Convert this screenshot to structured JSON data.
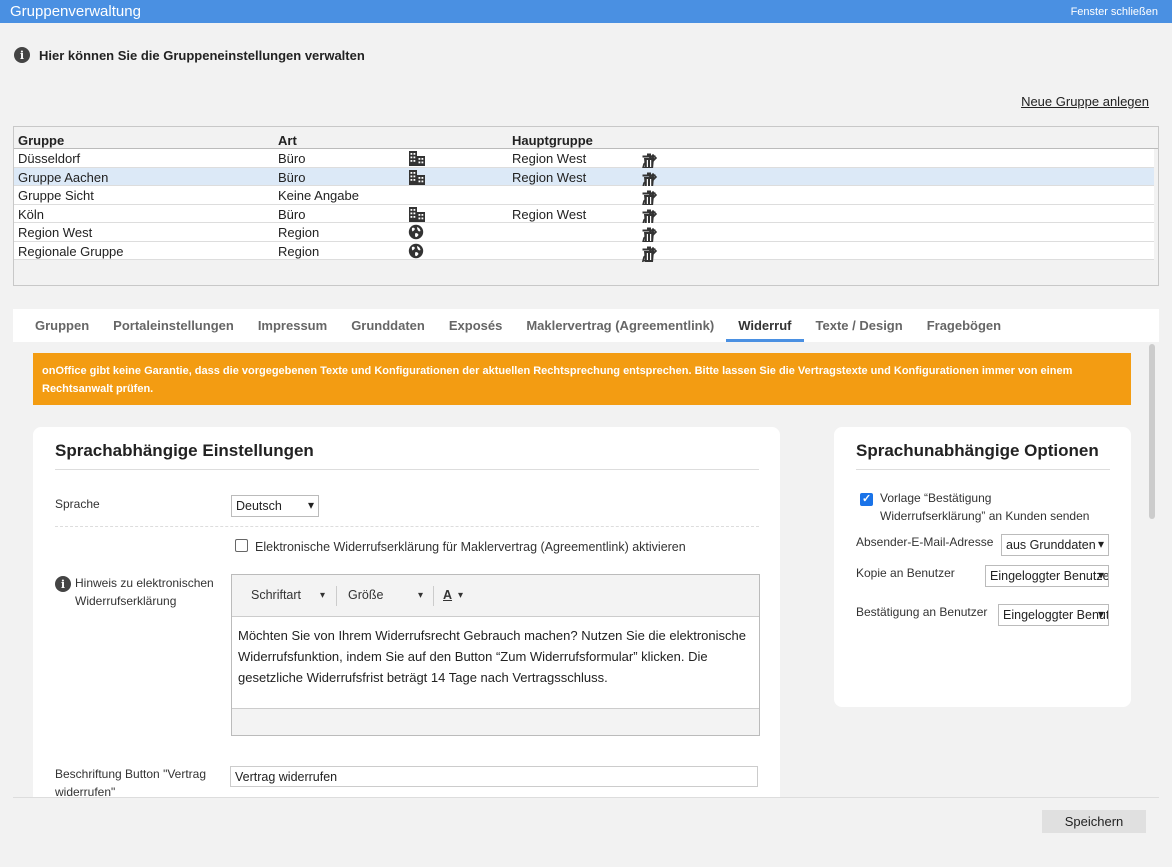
{
  "window": {
    "title": "Gruppenverwaltung",
    "close_label": "Fenster schließen"
  },
  "info": {
    "text": "Hier können Sie die Gruppeneinstellungen verwalten"
  },
  "new_group_label": "Neue Gruppe anlegen",
  "table": {
    "headers": {
      "gruppe": "Gruppe",
      "art": "Art",
      "hauptgruppe": "Hauptgruppe"
    },
    "rows": [
      {
        "gruppe": "Düsseldorf",
        "art": "Büro",
        "icon": "building-icon",
        "hauptgruppe": "Region West"
      },
      {
        "gruppe": "Gruppe Aachen",
        "art": "Büro",
        "icon": "building-icon",
        "hauptgruppe": "Region West"
      },
      {
        "gruppe": "Gruppe Sicht",
        "art": "Keine Angabe",
        "icon": "",
        "hauptgruppe": ""
      },
      {
        "gruppe": "Köln",
        "art": "Büro",
        "icon": "building-icon",
        "hauptgruppe": "Region West"
      },
      {
        "gruppe": "Region West",
        "art": "Region",
        "icon": "globe-icon",
        "hauptgruppe": ""
      },
      {
        "gruppe": "Regionale Gruppe",
        "art": "Region",
        "icon": "globe-icon",
        "hauptgruppe": ""
      }
    ]
  },
  "tabs": [
    {
      "label": "Gruppen"
    },
    {
      "label": "Portaleinstellungen"
    },
    {
      "label": "Impressum"
    },
    {
      "label": "Grunddaten"
    },
    {
      "label": "Exposés"
    },
    {
      "label": "Maklervertrag (Agreementlink)"
    },
    {
      "label": "Widerruf"
    },
    {
      "label": "Texte / Design"
    },
    {
      "label": "Fragebögen"
    }
  ],
  "warning": "onOffice gibt keine Garantie, dass die vorgegebenen Texte und Konfigurationen der aktuellen Rechtsprechung entsprechen. Bitte lassen Sie die Vertragstexte und Konfigurationen immer von einem Rechtsanwalt prüfen.",
  "left_card": {
    "title": "Sprachabhängige Einstellungen",
    "sprache_label": "Sprache",
    "sprache_value": "Deutsch",
    "checkbox_label": "Elektronische Widerrufserklärung für Maklervertrag (Agreementlink) aktivieren",
    "hinweis_label_1": "Hinweis zu elektronischen",
    "hinweis_label_2": "Widerrufserklärung",
    "editor": {
      "font_label": "Schriftart",
      "size_label": "Größe",
      "color_label": "A",
      "text": "Möchten Sie von Ihrem Widerrufsrecht Gebrauch machen? Nutzen Sie die elektronische Widerrufsfunktion, indem Sie auf den Button “Zum Widerrufsformular” klicken. Die gesetzliche Widerrufsfrist beträgt 14 Tage nach Vertragsschluss."
    },
    "button_label_1": "Beschriftung Button \"Vertrag",
    "button_label_2": "widerrufen\"",
    "button_value": "Vertrag widerrufen"
  },
  "right_card": {
    "title": "Sprachunabhängige Optionen",
    "vorlage_label_1": "Vorlage “Bestätigung",
    "vorlage_label_2": "Widerrufserklärung” an Kunden senden",
    "absender_label": "Absender-E-Mail-Adresse",
    "absender_value": "aus Grunddaten",
    "kopie_label": "Kopie an Benutzer",
    "kopie_value": "Eingeloggter Benutzer",
    "bestaetigung_label": "Bestätigung an Benutzer",
    "bestaetigung_value": "Eingeloggter Benutzer"
  },
  "save_label": "Speichern",
  "colors": {
    "accent": "#4a90e2",
    "warning": "#f39c12",
    "checkbox": "#1a73e8"
  }
}
